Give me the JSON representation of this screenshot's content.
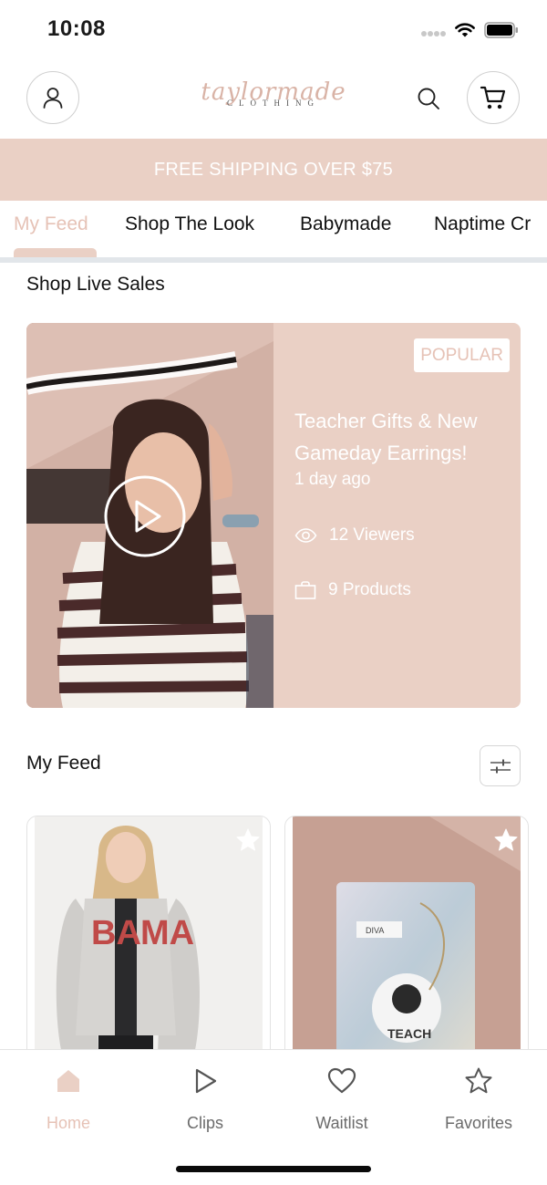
{
  "status_bar": {
    "time": "10:08"
  },
  "header": {
    "logo_script": "taylormade",
    "logo_sub": "CLOTHING",
    "icons": [
      "account-icon",
      "search-icon",
      "cart-icon"
    ]
  },
  "banner": {
    "text": "FREE SHIPPING OVER $75"
  },
  "tabs": [
    {
      "label": "My Feed",
      "active": true
    },
    {
      "label": "Shop The Look"
    },
    {
      "label": "Babymade"
    },
    {
      "label": "Naptime Cr"
    }
  ],
  "live_sales": {
    "title": "Shop Live Sales",
    "card": {
      "badge": "POPULAR",
      "title": "Teacher Gifts & New Gameday Earrings!",
      "time": "1 day ago",
      "viewers": "12 Viewers",
      "products": "9 Products"
    }
  },
  "feed": {
    "title": "My Feed",
    "products": [
      {
        "image": "woman in grey BAMA cardigan"
      },
      {
        "image": "holographic pouch with TEACH ornament"
      }
    ]
  },
  "tabbar": [
    {
      "label": "Home",
      "icon": "home-icon",
      "active": true
    },
    {
      "label": "Clips",
      "icon": "play-icon"
    },
    {
      "label": "Waitlist",
      "icon": "heart-icon"
    },
    {
      "label": "Favorites",
      "icon": "star-icon"
    }
  ],
  "colors": {
    "accent": "#ead0c5",
    "accent_text": "#e6c2b6"
  }
}
